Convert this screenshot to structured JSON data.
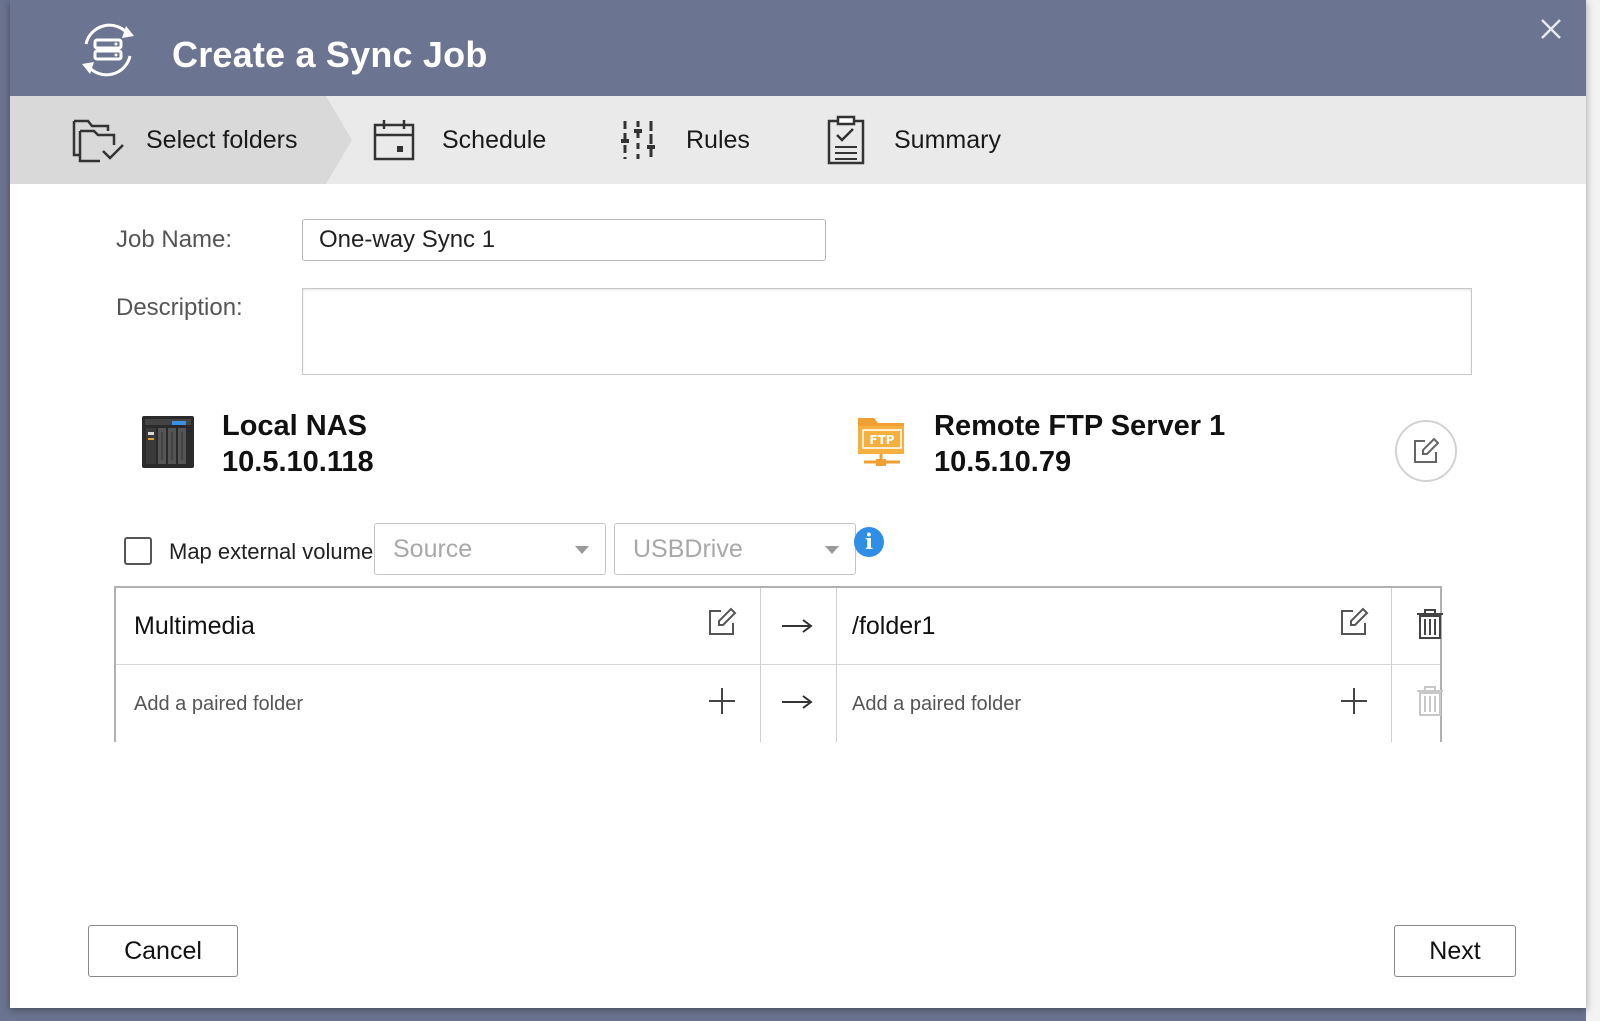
{
  "dialog": {
    "title": "Create a Sync Job",
    "app_icon": "sync-drive-icon",
    "close_icon": "close-icon"
  },
  "steps": [
    {
      "label": "Select folders",
      "icon": "folder-check-icon",
      "active": true
    },
    {
      "label": "Schedule",
      "icon": "calendar-icon",
      "active": false
    },
    {
      "label": "Rules",
      "icon": "sliders-icon",
      "active": false
    },
    {
      "label": "Summary",
      "icon": "clipboard-check-icon",
      "active": false
    }
  ],
  "form": {
    "job_name_label": "Job Name:",
    "job_name_value": "One-way Sync 1",
    "description_label": "Description:",
    "description_value": ""
  },
  "source_device": {
    "name": "Local NAS",
    "ip": "10.5.10.118",
    "icon": "nas-icon"
  },
  "target_device": {
    "name": "Remote FTP Server 1",
    "ip": "10.5.10.79",
    "icon": "ftp-server-icon",
    "badge": "FTP"
  },
  "map_external": {
    "label": "Map external volume",
    "checked": false,
    "source_select": "Source",
    "drive_select": "USBDrive"
  },
  "folder_pairs": {
    "rows": [
      {
        "source": "Multimedia",
        "target": "/folder1"
      }
    ],
    "add_row": {
      "source_placeholder": "Add a paired folder",
      "target_placeholder": "Add a paired folder"
    }
  },
  "footer": {
    "cancel_label": "Cancel",
    "next_label": "Next"
  },
  "colors": {
    "titlebar": "#6b7490",
    "step_bar": "#eaeaea",
    "active_step": "#d9d9d9",
    "info_blue": "#2f8fe6",
    "ftp_orange": "#f0a030"
  }
}
